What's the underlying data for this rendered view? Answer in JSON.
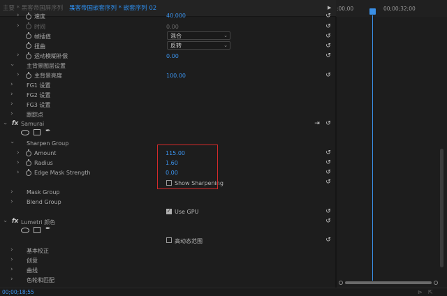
{
  "header": {
    "master_tab": "主要 * 黑客帝国屏序列",
    "active_tab": "黑客帝国嵌套序列 * 嵌套序列 02",
    "timecode_start": ":00;00",
    "timecode_end": "00;00;32;00"
  },
  "rows": {
    "speed": {
      "label": "速度",
      "value": "40.000"
    },
    "duration": {
      "label": "时间",
      "value": "0.00"
    },
    "frame_interp": {
      "label": "帧插值",
      "value": "混合"
    },
    "warp": {
      "label": "扭曲",
      "value": "反转"
    },
    "motion_blur": {
      "label": "运动模糊补偿",
      "value": "0.00"
    },
    "bg_layer": {
      "label": "主背景图层设置"
    },
    "bg_opacity": {
      "label": "主背景亮度",
      "value": "100.00"
    },
    "fg1": {
      "label": "FG1 设置"
    },
    "fg2": {
      "label": "FG2 设置"
    },
    "fg3": {
      "label": "FG3 设置"
    },
    "tracking": {
      "label": "跟踪点"
    }
  },
  "effects": {
    "samurai": {
      "fx": "fx",
      "name": "Samurai"
    },
    "sharpen_group": {
      "label": "Sharpen Group"
    },
    "amount": {
      "label": "Amount",
      "value": "115.00"
    },
    "radius": {
      "label": "Radius",
      "value": "1.60"
    },
    "edge_mask": {
      "label": "Edge Mask Strength",
      "value": "0.00"
    },
    "show_sharpening": {
      "label": "Show Sharpening",
      "checked": false
    },
    "mask_group": {
      "label": "Mask Group"
    },
    "blend_group": {
      "label": "Blend Group"
    },
    "use_gpu": {
      "label": "Use GPU",
      "checked": true
    },
    "lumetri": {
      "fx": "fx",
      "name": "Lumetri 颜色"
    },
    "hdr": {
      "label": "高动态范围",
      "checked": false
    },
    "basic": {
      "label": "基本校正"
    },
    "creative": {
      "label": "创意"
    },
    "curves": {
      "label": "曲线"
    },
    "wheels": {
      "label": "色轮和匹配"
    }
  },
  "footer": {
    "timecode": "00;00;18;55"
  },
  "icons": {
    "reset": "reset-icon",
    "stopwatch": "stopwatch-icon",
    "pen": "pen-mask-icon",
    "ellipse": "ellipse-mask-icon",
    "rect": "rectangle-mask-icon"
  },
  "colors": {
    "accent": "#3b93ec",
    "highlight": "#d32a2a"
  }
}
